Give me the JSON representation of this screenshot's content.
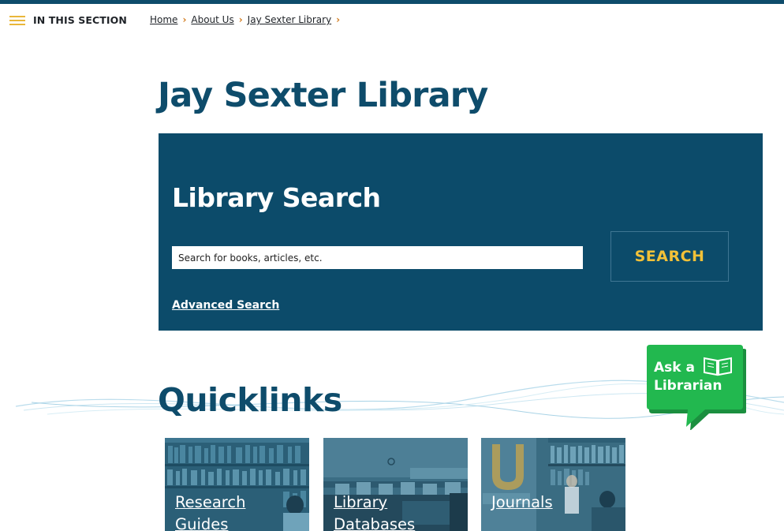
{
  "header": {
    "section_label": "IN THIS SECTION",
    "breadcrumb": [
      "Home",
      "About Us",
      "Jay Sexter Library"
    ]
  },
  "page_title": "Jay Sexter Library",
  "search": {
    "title": "Library Search",
    "placeholder": "Search for books, articles, etc.",
    "button_label": "SEARCH",
    "advanced_label": "Advanced Search"
  },
  "ask_librarian": {
    "line1": "Ask a",
    "line2": "Librarian"
  },
  "quicklinks": {
    "title": "Quicklinks",
    "tiles": [
      {
        "label": "Research Guides"
      },
      {
        "label": "Library Databases"
      },
      {
        "label": "Journals"
      }
    ]
  },
  "colors": {
    "brand_blue": "#0e4c6b",
    "accent_gold": "#f2c138",
    "crumb_orange": "#d27a1c",
    "ask_green": "#1fb14d"
  }
}
